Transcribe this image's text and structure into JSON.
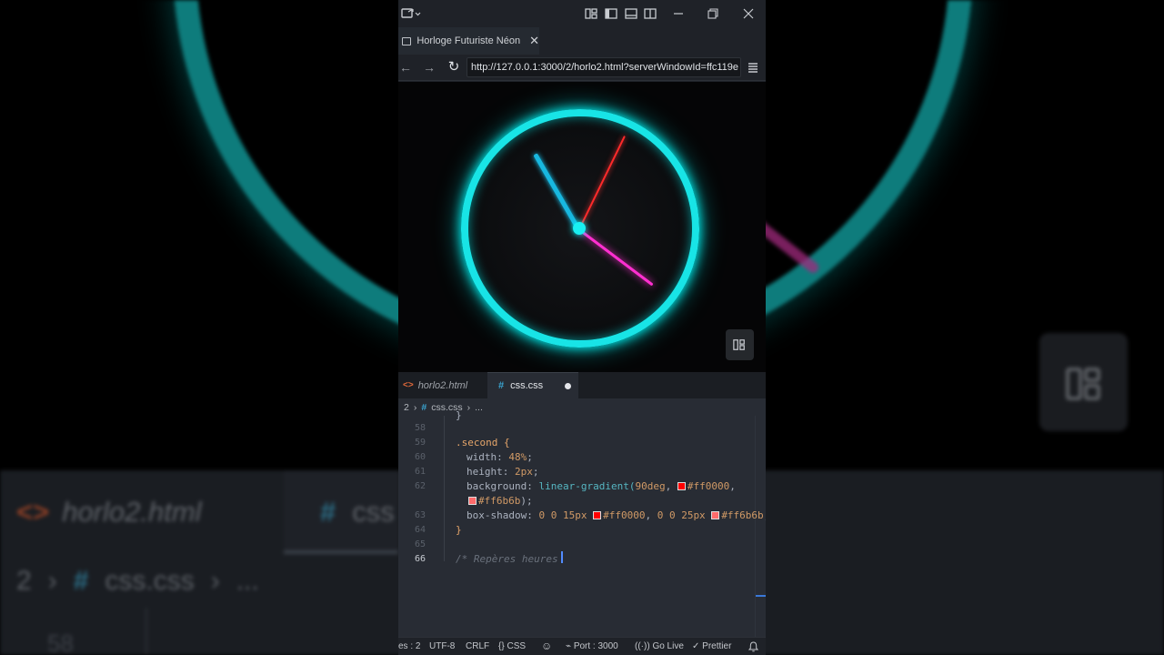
{
  "background": {
    "tab_html_label": "horlo2.html",
    "tab_css_label": "css",
    "crumb_num": "2",
    "crumb_file": "css.css",
    "crumb_more": "...",
    "line_num": "58"
  },
  "window": {
    "tab_title": "Horloge Futuriste Néon",
    "url": "http://127.0.0.1:3000/2/horlo2.html?serverWindowId=ffc119e",
    "colors": {
      "ring": "#18e4e6",
      "hour_hand": "#18b8e0",
      "minute_hand": "#ff2fd0",
      "second_hand": "#ff2a2a"
    }
  },
  "editor": {
    "tabs": [
      {
        "label": "horlo2.html",
        "icon": "html-file-icon"
      },
      {
        "label": "css.css",
        "icon": "css-file-icon",
        "modified": true
      }
    ],
    "breadcrumb": {
      "segment1": "2",
      "file": "css.css",
      "more": "..."
    },
    "line_numbers": [
      "58",
      "59",
      "60",
      "61",
      "62",
      "63",
      "64",
      "65",
      "66"
    ],
    "code": {
      "line57_tail": "}",
      "selector": ".second {",
      "width_prop": "width:",
      "width_val": "48%",
      "height_prop": "height:",
      "height_val": "2px",
      "bg_prop": "background:",
      "bg_fn": "linear-gradient(",
      "bg_deg": "90deg",
      "hex_red": "#ff0000",
      "hex_pink": "#ff6b6b",
      "shadow_prop": "box-shadow:",
      "shadow_a": "0 0 15px",
      "shadow_b": "0 0 25px",
      "close_brace": "}",
      "comment": "/* Repères heures "
    }
  },
  "statusbar": {
    "spaces": "es : 2",
    "encoding": "UTF-8",
    "eol": "CRLF",
    "language": "CSS",
    "port": "Port : 3000",
    "golive": "Go Live",
    "prettier": "Prettier"
  }
}
